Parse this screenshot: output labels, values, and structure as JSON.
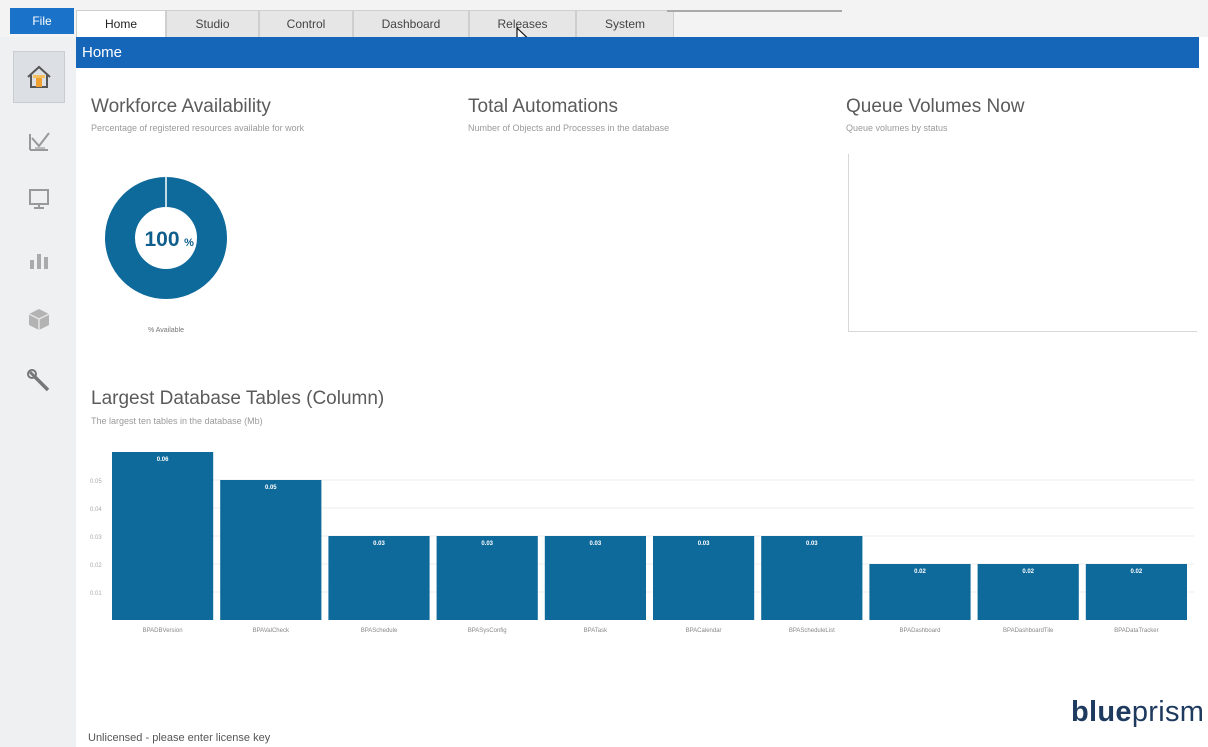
{
  "menubar": {
    "file_label": "File",
    "tabs": [
      {
        "label": "Home"
      },
      {
        "label": "Studio"
      },
      {
        "label": "Control"
      },
      {
        "label": "Dashboard"
      },
      {
        "label": "Releases"
      },
      {
        "label": "System"
      }
    ]
  },
  "sidebar": {
    "items": [
      {
        "icon": "home-icon",
        "active": true
      },
      {
        "icon": "studio-icon",
        "active": false
      },
      {
        "icon": "monitor-icon",
        "active": false
      },
      {
        "icon": "chart-icon",
        "active": false
      },
      {
        "icon": "package-icon",
        "active": false
      },
      {
        "icon": "wrench-icon",
        "active": false
      }
    ]
  },
  "header": {
    "title": "Home"
  },
  "workforce": {
    "title": "Workforce Availability",
    "subtitle": "Percentage of registered resources available for work",
    "value_number": "100",
    "value_suffix": "%",
    "legend_label": "% Available"
  },
  "automations": {
    "title": "Total Automations",
    "subtitle": "Number of Objects and Processes in the database"
  },
  "queues": {
    "title": "Queue Volumes Now",
    "subtitle": "Queue volumes by status"
  },
  "tables_chart": {
    "title": "Largest Database Tables (Column)",
    "subtitle": "The largest ten tables in the database (Mb)"
  },
  "chart_data": {
    "type": "bar",
    "title": "Largest Database Tables (Column)",
    "subtitle": "The largest ten tables in the database (Mb)",
    "categories": [
      "BPADBVersion",
      "BPAValCheck",
      "BPASchedule",
      "BPASysConfig",
      "BPATask",
      "BPACalendar",
      "BPAScheduleList",
      "BPADashboard",
      "BPADashboardTile",
      "BPADataTracker"
    ],
    "values": [
      0.06,
      0.05,
      0.03,
      0.03,
      0.03,
      0.03,
      0.03,
      0.02,
      0.02,
      0.02
    ],
    "data_labels": [
      "0.06",
      "0.05",
      "0.03",
      "0.03",
      "0.03",
      "0.03",
      "0.03",
      "0.02",
      "0.02",
      "0.02"
    ],
    "yticks": [
      "0.05",
      "0.04",
      "0.03",
      "0.02",
      "0.01"
    ],
    "ylim": [
      0,
      0.06
    ],
    "grid": true,
    "color": "#0f6a9c"
  },
  "footer": {
    "status_text": "Unlicensed - please enter license key"
  },
  "brand": {
    "logo_bold": "blue",
    "logo_light": "prism"
  },
  "colors": {
    "accent": "#1565b8",
    "bar": "#0f6a9c",
    "donut": "#0f6a9c"
  }
}
